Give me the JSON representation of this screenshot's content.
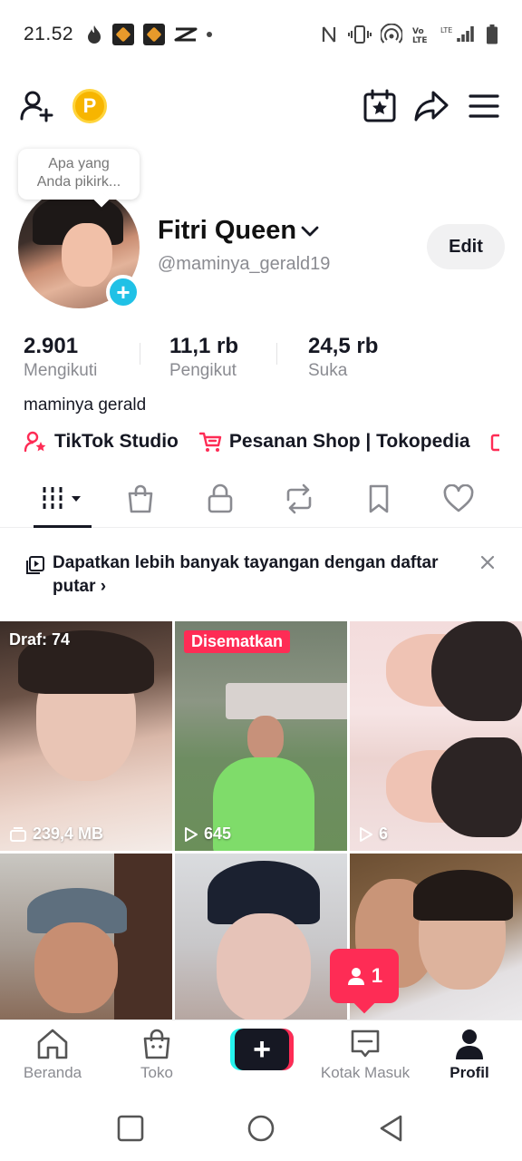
{
  "status_bar": {
    "time": "21.52",
    "left_icons": [
      "flame-icon",
      "app-notification-icon",
      "app-notification-icon",
      "capcut-icon",
      "dot-icon"
    ],
    "right_icons": [
      "nfc-icon",
      "vibrate-icon",
      "hotspot-icon",
      "volte-icon",
      "signal-icon",
      "battery-icon"
    ]
  },
  "top_bar": {
    "icons": [
      "add-user-icon",
      "coin-icon",
      "calendar-star-icon",
      "share-icon",
      "menu-icon"
    ],
    "coin_letter": "P"
  },
  "profile": {
    "note_bubble": [
      "Apa yang",
      "Anda pikirk..."
    ],
    "display_name": "Fitri Queen",
    "username": "@maminya_gerald19",
    "edit_label": "Edit",
    "stats": [
      {
        "value": "2.901",
        "label": "Mengikuti"
      },
      {
        "value": "11,1 rb",
        "label": "Pengikut"
      },
      {
        "value": "24,5 rb",
        "label": "Suka"
      }
    ],
    "bio": "maminya gerald",
    "links": [
      {
        "label": "TikTok Studio",
        "icon": "person-star-icon"
      },
      {
        "label": "Pesanan Shop | Tokopedia",
        "icon": "cart-icon"
      }
    ]
  },
  "tabs": [
    {
      "name": "videos",
      "icon": "grid-bars-icon",
      "active": true
    },
    {
      "name": "shop",
      "icon": "shopping-bag-icon",
      "active": false
    },
    {
      "name": "private",
      "icon": "lock-icon",
      "active": false
    },
    {
      "name": "reposts",
      "icon": "repost-icon",
      "active": false
    },
    {
      "name": "saved",
      "icon": "bookmark-icon",
      "active": false
    },
    {
      "name": "liked",
      "icon": "heart-icon",
      "active": false
    }
  ],
  "playlist_banner": {
    "text": "Dapatkan lebih banyak tayangan dengan daftar putar",
    "icon": "playlist-icon"
  },
  "videos": [
    {
      "top_label": "Draf: 74",
      "meta": "239,4 MB",
      "meta_icon": "storage-icon"
    },
    {
      "badge": "Disematkan",
      "meta": "645",
      "meta_icon": "play-icon"
    },
    {
      "meta": "6",
      "meta_icon": "play-icon"
    },
    {},
    {},
    {}
  ],
  "inbox_popup": {
    "count": "1",
    "icon": "person-icon"
  },
  "bottom_nav": [
    {
      "label": "Beranda",
      "icon": "home-icon",
      "active": false
    },
    {
      "label": "Toko",
      "icon": "shop-icon",
      "active": false
    },
    {
      "label": "",
      "icon": "create-plus-icon",
      "active": false
    },
    {
      "label": "Kotak Masuk",
      "icon": "inbox-icon",
      "active": false
    },
    {
      "label": "Profil",
      "icon": "profile-icon",
      "active": true
    }
  ],
  "system_nav": [
    "recent-apps-icon",
    "home-circle-icon",
    "back-icon"
  ],
  "colors": {
    "accent": "#fe2c55",
    "cyan": "#25f4ee",
    "text_primary": "#161823",
    "text_secondary": "#8a8b91",
    "avatar_add": "#20c1e6",
    "coin": "#f7b500"
  }
}
